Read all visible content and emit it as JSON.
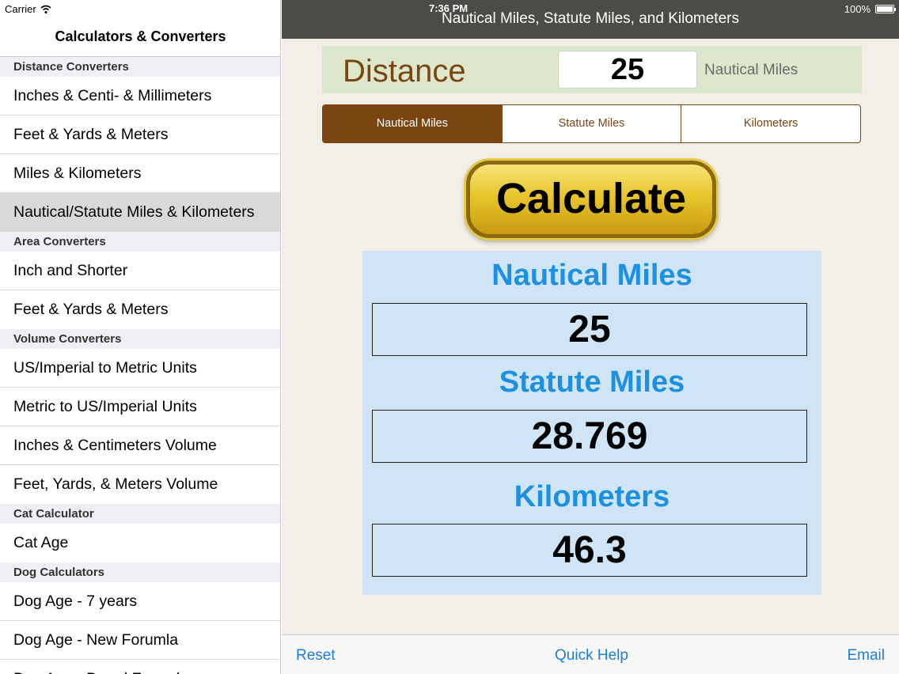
{
  "status_bar": {
    "carrier": "Carrier",
    "time": "7:36 PM",
    "battery": "100%"
  },
  "sidebar": {
    "title": "Calculators & Converters",
    "sections": [
      {
        "header": "Distance Converters",
        "items": [
          "Inches & Centi- & Millimeters",
          "Feet & Yards & Meters",
          "Miles & Kilometers",
          "Nautical/Statute Miles & Kilometers"
        ]
      },
      {
        "header": "Area Converters",
        "items": [
          "Inch and Shorter",
          "Feet & Yards & Meters"
        ]
      },
      {
        "header": "Volume Converters",
        "items": [
          "US/Imperial to Metric Units",
          "Metric to US/Imperial Units",
          "Inches & Centimeters Volume",
          "Feet, Yards, & Meters Volume"
        ]
      },
      {
        "header": "Cat Calculator",
        "items": [
          "Cat Age"
        ]
      },
      {
        "header": "Dog Calculators",
        "items": [
          "Dog Age - 7 years",
          "Dog Age - New Forumla",
          "Dog Age - Breed Formula"
        ]
      }
    ]
  },
  "main": {
    "nav_title": "Nautical Miles, Statute Miles, and Kilometers",
    "distance_label": "Distance",
    "distance_value": "25",
    "distance_unit": "Nautical Miles",
    "segments": [
      "Nautical Miles",
      "Statute Miles",
      "Kilometers"
    ],
    "calculate_label": "Calculate",
    "results": [
      {
        "label": "Nautical Miles",
        "value": "25"
      },
      {
        "label": "Statute Miles",
        "value": "28.769"
      },
      {
        "label": "Kilometers",
        "value": "46.3"
      }
    ]
  },
  "toolbar": {
    "reset": "Reset",
    "quick_help": "Quick Help",
    "email": "Email"
  },
  "colors": {
    "accent_brown": "#7a4511",
    "result_blue": "#1e90e0",
    "link_blue": "#1b7fd6"
  }
}
